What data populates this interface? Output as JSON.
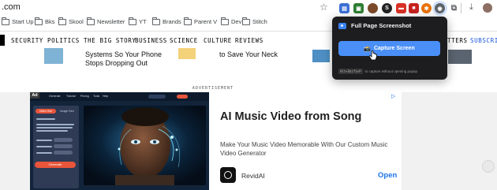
{
  "browser": {
    "url_fragment": ".com",
    "bookmarks": [
      {
        "label": "Start Up"
      },
      {
        "label": "Bks"
      },
      {
        "label": "Skool"
      },
      {
        "label": "Newsletter"
      },
      {
        "label": "YT"
      },
      {
        "label": "Brands"
      },
      {
        "label": "Parent V"
      },
      {
        "label": "Dev"
      },
      {
        "label": "Stitch"
      }
    ],
    "extension_icons": [
      "doc-icon",
      "frame-icon",
      "avatar-icon",
      "s-icon",
      "red-icon",
      "red-square-icon",
      "orange-icon",
      "puzzle-icon"
    ]
  },
  "site": {
    "nav": [
      "SECURITY",
      "POLITICS",
      "THE BIG STORY",
      "BUSINESS",
      "SCIENCE",
      "CULTURE",
      "REVIEWS"
    ],
    "nav_right_partial": "TTERS",
    "subscribe_partial": "SUBSCRIB",
    "stories": [
      {
        "line1": "Systems So Your Phone",
        "line2": "Stops Dropping Out"
      },
      {
        "line1": "to Save Your Neck"
      }
    ],
    "advertisement_label": "ADVERTISEMENT"
  },
  "ad": {
    "badge": "Ad",
    "title": "AI Music Video from Song",
    "description": "Make Your Music Video Memorable With Our Custom Music Video Generator",
    "brand": "RevidAI",
    "cta": "Open",
    "app_nav": [
      "Generate",
      "Tutorial",
      "Pricing",
      "Tools",
      "Help"
    ],
    "app_tabs": [
      "Video Gen",
      "Image Gen"
    ],
    "app_generate": "Generate"
  },
  "popup": {
    "title": "Full Page Screenshot",
    "capture_label": "Capture Screen",
    "shortcut": "Alt+Shift+P",
    "hint_text": "to capture without opening popup"
  },
  "colors": {
    "accent_blue": "#4a8ff7",
    "popup_bg": "#1d1d1f",
    "link_blue": "#1a73e8",
    "generate_orange": "#e8553a"
  }
}
